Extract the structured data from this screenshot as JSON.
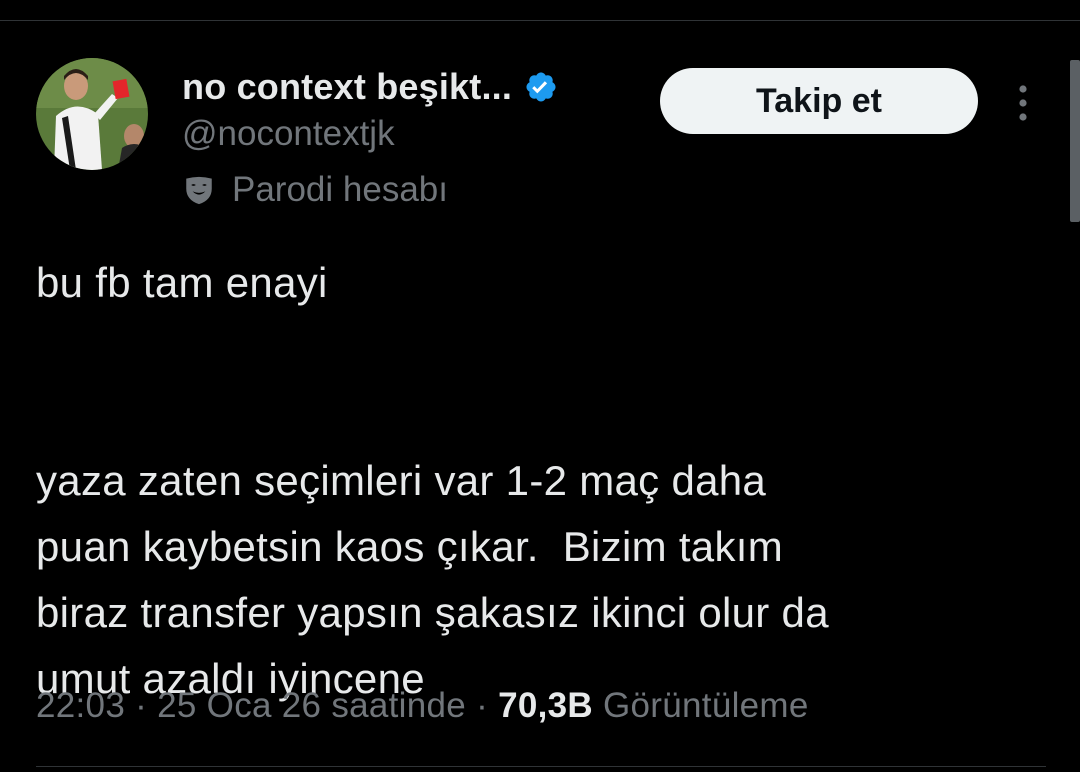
{
  "tweet": {
    "author": {
      "display_name": "no context beşikt...",
      "handle": "@nocontextjk",
      "verified_icon": "verified-badge-icon",
      "label_icon": "theater-mask-icon",
      "label": "Parodi hesabı"
    },
    "follow_button_label": "Takip et",
    "more_icon": "more-vertical-icon",
    "text": "bu fb tam enayi\n\n\nyaza zaten seçimleri var 1-2 maç daha\npuan kaybetsin kaos çıkar.  Bizim takım\nbiraz transfer yapsın şakasız ikinci olur da\numut azaldı iyincene",
    "meta": {
      "time": "22:03",
      "separator": " · ",
      "date": "25 Oca 26 saatinde",
      "views_count": "70,3B",
      "views_label": "Görüntüleme"
    }
  },
  "colors": {
    "background": "#000000",
    "text_primary": "#e7e9ea",
    "text_secondary": "#71767b",
    "verified_blue": "#1d9bf0",
    "button_bg": "#eff3f4",
    "button_text": "#0f1419",
    "divider": "#2f3336"
  }
}
